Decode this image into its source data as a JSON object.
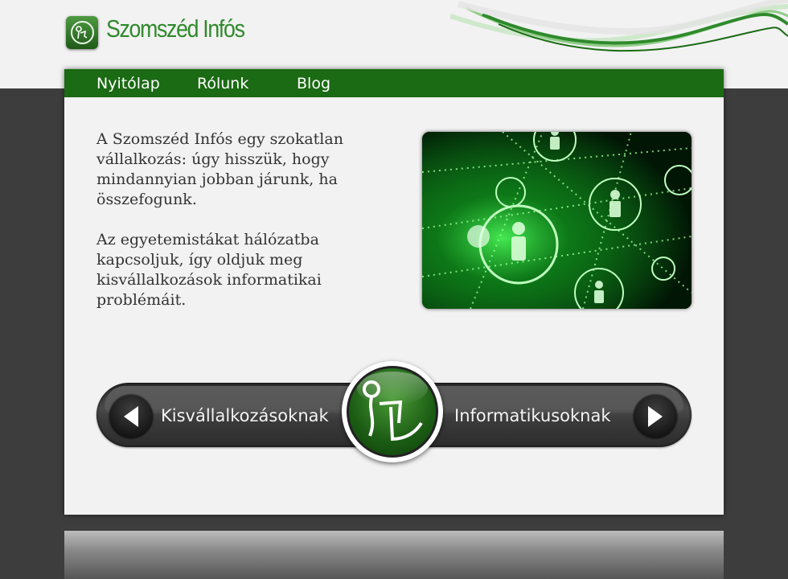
{
  "brand": {
    "name": "Szomszéd Infós",
    "color": "#2f8a2c",
    "logo_icon": "user-network-icon"
  },
  "nav": {
    "items": [
      {
        "label": "Nyitólap"
      },
      {
        "label": "Rólunk"
      },
      {
        "label": "Blog"
      }
    ],
    "background": "#1b6a14"
  },
  "intro": {
    "paragraphs": [
      "A Szomszéd Infós egy szokatlan vállalkozás: úgy hisszük, hogy mindannyian jobban járunk, ha összefogunk.",
      "Az egyetemistákat hálózatba kapcsoljuk, így oldjuk meg kisvállalkozások informatikai problémáit."
    ]
  },
  "hero_image": {
    "subject": "network-people-icon",
    "accent": "#3cff4a"
  },
  "cta": {
    "left_label": "Kisvállalkozásoknak",
    "left_icon": "arrow-left-icon",
    "right_label": "Informatikusoknak",
    "right_icon": "arrow-right-icon",
    "center_icon": "user-network-icon"
  }
}
